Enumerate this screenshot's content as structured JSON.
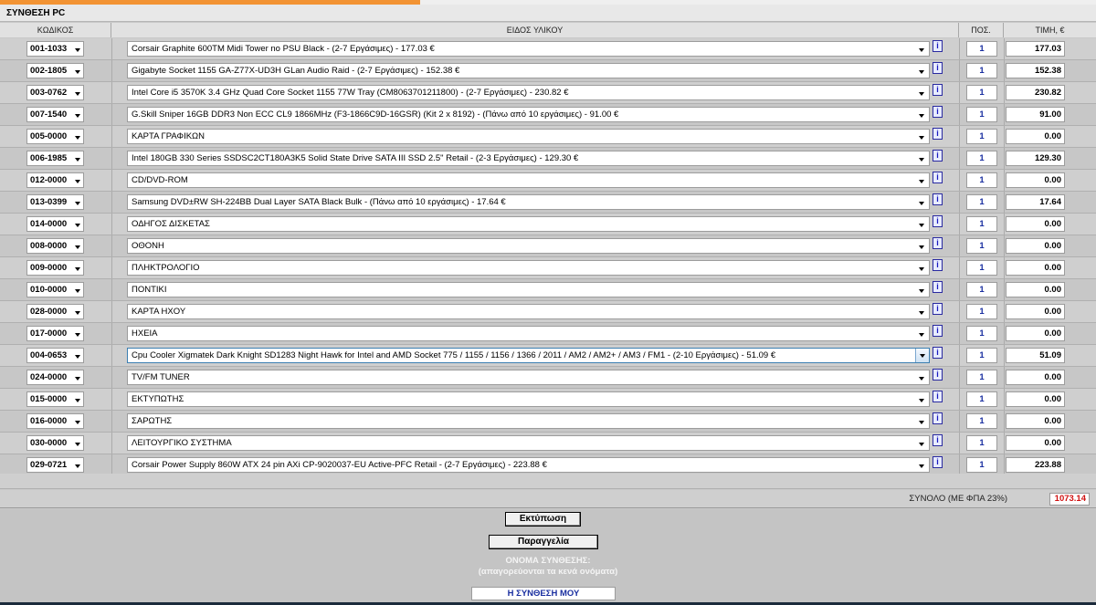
{
  "title": "ΣΥΝΘΕΣΗ PC",
  "headers": {
    "code": "ΚΩΔΙΚΟΣ",
    "item": "ΕΙΔΟΣ ΥΛΙΚΟΥ",
    "qty": "ΠΟΣ.",
    "price": "ΤΙΜΗ, €"
  },
  "info_label": "i",
  "rows": [
    {
      "code": "001-1033",
      "desc": "Corsair Graphite 600TM Midi Tower no PSU Black - (2-7 Εργάσιμες) - 177.03 €",
      "qty": "1",
      "price": "177.03"
    },
    {
      "code": "002-1805",
      "desc": "Gigabyte Socket 1155 GA-Z77X-UD3H GLan Audio Raid - (2-7 Εργάσιμες) - 152.38 €",
      "qty": "1",
      "price": "152.38"
    },
    {
      "code": "003-0762",
      "desc": "Intel Core i5 3570K 3.4 GHz Quad Core Socket 1155 77W Tray (CM8063701211800) - (2-7 Εργάσιμες) - 230.82 €",
      "qty": "1",
      "price": "230.82"
    },
    {
      "code": "007-1540",
      "desc": "G.Skill Sniper 16GB DDR3 Non ECC CL9 1866MHz (F3-1866C9D-16GSR) (Kit 2 x 8192) - (Πάνω από 10 εργάσιμες) - 91.00 €",
      "qty": "1",
      "price": "91.00"
    },
    {
      "code": "005-0000",
      "desc": "ΚΑΡΤΑ ΓΡΑΦΙΚΩΝ",
      "qty": "1",
      "price": "0.00"
    },
    {
      "code": "006-1985",
      "desc": "Intel 180GB 330 Series SSDSC2CT180A3K5 Solid State Drive SATA III SSD 2.5\" Retail - (2-3 Εργάσιμες) - 129.30 €",
      "qty": "1",
      "price": "129.30"
    },
    {
      "code": "012-0000",
      "desc": "CD/DVD-ROM",
      "qty": "1",
      "price": "0.00"
    },
    {
      "code": "013-0399",
      "desc": "Samsung DVD±RW SH-224BB Dual Layer SATA Black Bulk - (Πάνω από 10 εργάσιμες) - 17.64 €",
      "qty": "1",
      "price": "17.64"
    },
    {
      "code": "014-0000",
      "desc": "ΟΔΗΓΟΣ ΔΙΣΚΕΤΑΣ",
      "qty": "1",
      "price": "0.00"
    },
    {
      "code": "008-0000",
      "desc": "ΟΘΟΝΗ",
      "qty": "1",
      "price": "0.00"
    },
    {
      "code": "009-0000",
      "desc": "ΠΛΗΚΤΡΟΛΟΓΙΟ",
      "qty": "1",
      "price": "0.00"
    },
    {
      "code": "010-0000",
      "desc": "ΠΟΝΤΙΚΙ",
      "qty": "1",
      "price": "0.00"
    },
    {
      "code": "028-0000",
      "desc": "ΚΑΡΤΑ ΗΧΟΥ",
      "qty": "1",
      "price": "0.00"
    },
    {
      "code": "017-0000",
      "desc": "ΗΧΕΙΑ",
      "qty": "1",
      "price": "0.00"
    },
    {
      "code": "004-0653",
      "desc": "Cpu Cooler Xigmatek Dark Knight SD1283 Night Hawk for Intel and AMD Socket 775 / 1155 / 1156 / 1366 / 2011 / AM2 / AM2+ / AM3 / FM1 - (2-10 Εργάσιμες) - 51.09 €",
      "qty": "1",
      "price": "51.09"
    },
    {
      "code": "024-0000",
      "desc": "TV/FM TUNER",
      "qty": "1",
      "price": "0.00"
    },
    {
      "code": "015-0000",
      "desc": "ΕΚΤΥΠΩΤΗΣ",
      "qty": "1",
      "price": "0.00"
    },
    {
      "code": "016-0000",
      "desc": "ΣΑΡΩΤΗΣ",
      "qty": "1",
      "price": "0.00"
    },
    {
      "code": "030-0000",
      "desc": "ΛΕΙΤΟΥΡΓΙΚΟ ΣΥΣΤΗΜΑ",
      "qty": "1",
      "price": "0.00"
    },
    {
      "code": "029-0721",
      "desc": "Corsair Power Supply 860W ATX 24 pin AXi CP-9020037-EU Active-PFC Retail - (2-7 Εργάσιμες) - 223.88 €",
      "qty": "1",
      "price": "223.88"
    }
  ],
  "total": {
    "label": "ΣΥΝΟΛΟ (ΜΕ ΦΠΑ 23%)",
    "value": "1073.14",
    "color": "#d01010"
  },
  "buttons": {
    "print": "Εκτύπωση",
    "order": "Παραγγελία"
  },
  "name_section": {
    "caption": "ΟΝΟΜΑ ΣΥΝΘΕΣΗΣ:",
    "note": "(απαγορεύονται τα κενά ονόματα)",
    "value": "Η ΣΥΝΘΕΣΗ ΜΟΥ"
  }
}
